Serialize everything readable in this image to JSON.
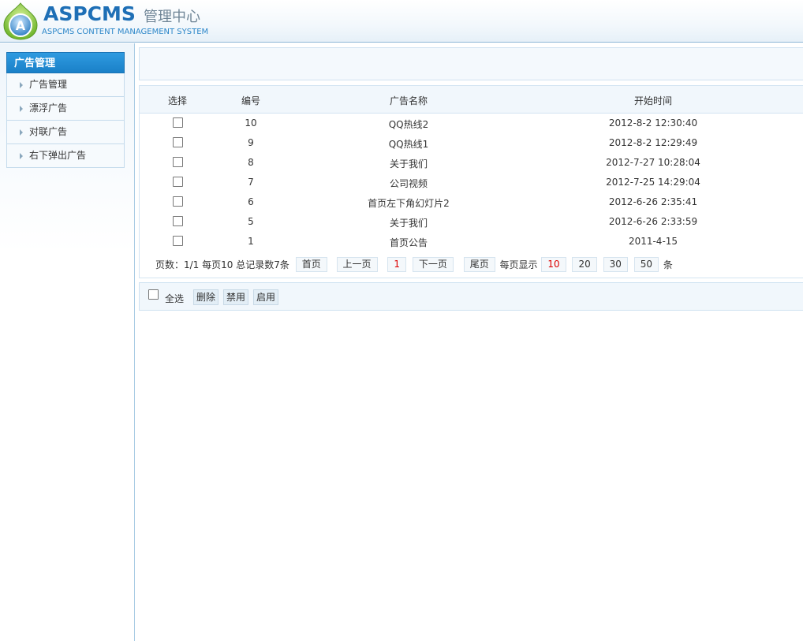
{
  "header": {
    "brand": "ASPCMS",
    "brand_sub": "管理中心",
    "brand_en": "ASPCMS CONTENT MANAGEMENT SYSTEM",
    "logo_letter": "A",
    "accent": "#1e6fb6"
  },
  "sidebar": {
    "title": "广告管理",
    "items": [
      {
        "label": "广告管理"
      },
      {
        "label": "漂浮广告"
      },
      {
        "label": "对联广告"
      },
      {
        "label": "右下弹出广告"
      }
    ]
  },
  "table": {
    "headers": {
      "select": "选择",
      "id": "编号",
      "name": "广告名称",
      "start_time": "开始时间"
    },
    "rows": [
      {
        "id": "10",
        "name": "QQ热线2",
        "start_time": "2012-8-2 12:30:40",
        "checked": false
      },
      {
        "id": "9",
        "name": "QQ热线1",
        "start_time": "2012-8-2 12:29:49",
        "checked": false
      },
      {
        "id": "8",
        "name": "关于我们",
        "start_time": "2012-7-27 10:28:04",
        "checked": false
      },
      {
        "id": "7",
        "name": "公司视频",
        "start_time": "2012-7-25 14:29:04",
        "checked": false
      },
      {
        "id": "6",
        "name": "首页左下角幻灯片2",
        "start_time": "2012-6-26 2:35:41",
        "checked": false
      },
      {
        "id": "5",
        "name": "关于我们",
        "start_time": "2012-6-26 2:33:59",
        "checked": false
      },
      {
        "id": "1",
        "name": "首页公告",
        "start_time": "2011-4-15",
        "checked": false
      }
    ]
  },
  "pager": {
    "info": "页数：1/1 每页10 总记录数7条",
    "first": "首页",
    "prev": "上一页",
    "current_page": "1",
    "next": "下一页",
    "last": "尾页",
    "per_page_label": "每页显示",
    "per_page_options": [
      "10",
      "20",
      "30",
      "50"
    ],
    "per_page_selected": "10",
    "unit": "条"
  },
  "actions": {
    "select_all": "全选",
    "delete": "删除",
    "disable": "禁用",
    "enable": "启用"
  }
}
